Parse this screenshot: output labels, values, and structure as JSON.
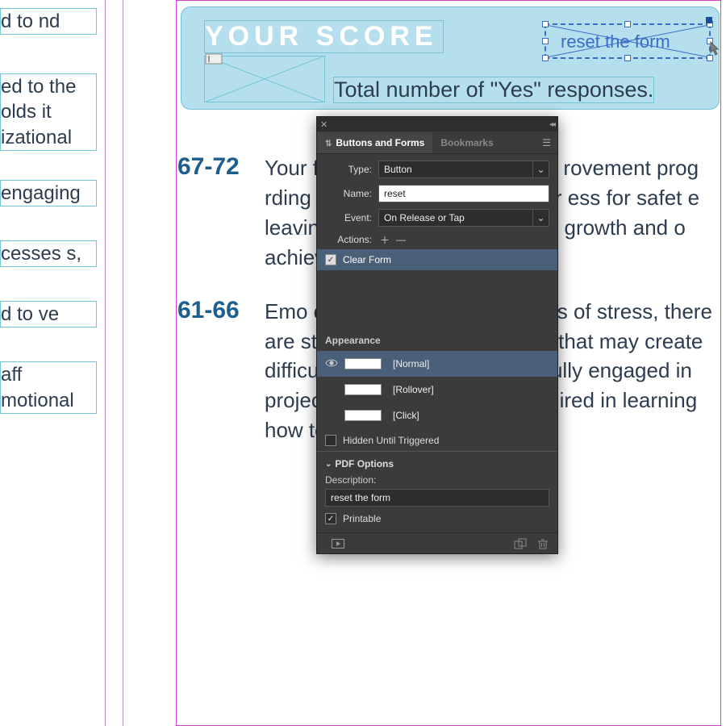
{
  "left_column": {
    "p1": "d to nd",
    "p2": "ed to the olds it izational",
    "p3": "engaging",
    "p4": "cesses s,",
    "p5": "d to ve",
    "p6": "aff motional"
  },
  "score_box": {
    "title": "YOUR SCORE",
    "subtitle": "Total number of \"Yes\" responses.",
    "reset_label": "reset the form"
  },
  "rows": [
    {
      "range": "67-72",
      "text": "Your                                              for the EmC                                         now is to impl                                       rovement prog                                       rding process to p                                          e joining your                                          ess for safet                                        e leaving. In addi                                       of nurturing and                                          growth and                                           o achieve unp"
    },
    {
      "range": "61-66",
      "text": "Emo                                           our culture, but in moments of stress, there are still unresolved interactions that may create difficulty for team members to fully engaged in projects. Additional work is required in learning how to anticipate your"
    }
  ],
  "panel": {
    "tabs": {
      "a": "Buttons and Forms",
      "b": "Bookmarks"
    },
    "type": {
      "label": "Type:",
      "value": "Button"
    },
    "name": {
      "label": "Name:",
      "value": "reset"
    },
    "event": {
      "label": "Event:",
      "value": "On Release or Tap"
    },
    "actions": {
      "label": "Actions:",
      "item": "Clear Form"
    },
    "appearance": {
      "label": "Appearance",
      "states": {
        "normal": "[Normal]",
        "rollover": "[Rollover]",
        "click": "[Click]"
      }
    },
    "hidden": "Hidden Until Triggered",
    "pdf": {
      "header": "PDF Options",
      "desc_label": "Description:",
      "desc_value": "reset the form",
      "printable": "Printable"
    }
  }
}
